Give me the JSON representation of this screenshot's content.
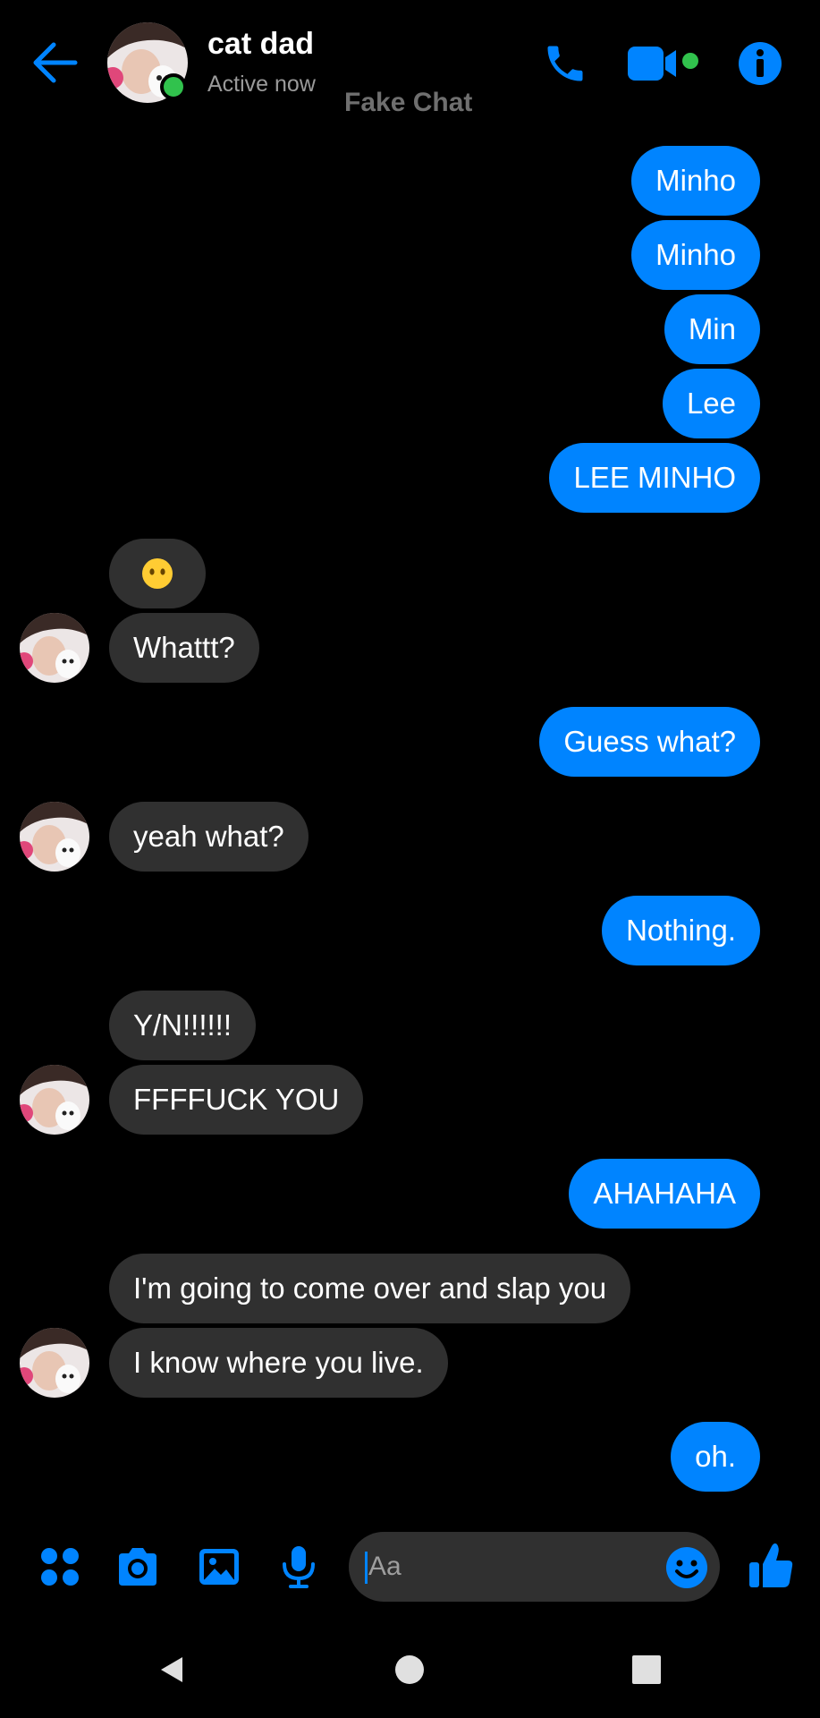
{
  "header": {
    "name": "cat dad",
    "status": "Active now",
    "watermark": "Fake Chat"
  },
  "icons": {
    "back": "arrow-left-icon",
    "call": "phone-icon",
    "video": "video-camera-icon",
    "info": "info-icon",
    "apps": "four-dots-icon",
    "camera": "camera-icon",
    "gallery": "image-icon",
    "mic": "microphone-icon",
    "emoji": "smiley-icon",
    "like": "thumbs-up-icon"
  },
  "colors": {
    "accent": "#0084ff",
    "online": "#31c24d",
    "received_bubble": "#303030",
    "background": "#000000"
  },
  "messages": [
    {
      "from": "me",
      "text": "Minho"
    },
    {
      "from": "me",
      "text": "Minho"
    },
    {
      "from": "me",
      "text": "Min"
    },
    {
      "from": "me",
      "text": "Lee"
    },
    {
      "from": "me",
      "text": "LEE MINHO"
    },
    {
      "from": "them",
      "text": "😶"
    },
    {
      "from": "them",
      "text": "Whattt?"
    },
    {
      "from": "me",
      "text": "Guess what?"
    },
    {
      "from": "them",
      "text": "yeah what?"
    },
    {
      "from": "me",
      "text": "Nothing."
    },
    {
      "from": "them",
      "text": "Y/N!!!!!!"
    },
    {
      "from": "them",
      "text": "FFFFUCK YOU"
    },
    {
      "from": "me",
      "text": "AHAHAHA"
    },
    {
      "from": "them",
      "text": "I'm going to come over and slap you"
    },
    {
      "from": "them",
      "text": "I know where you live."
    },
    {
      "from": "me",
      "text": "oh."
    }
  ],
  "composer": {
    "placeholder": "Aa"
  }
}
